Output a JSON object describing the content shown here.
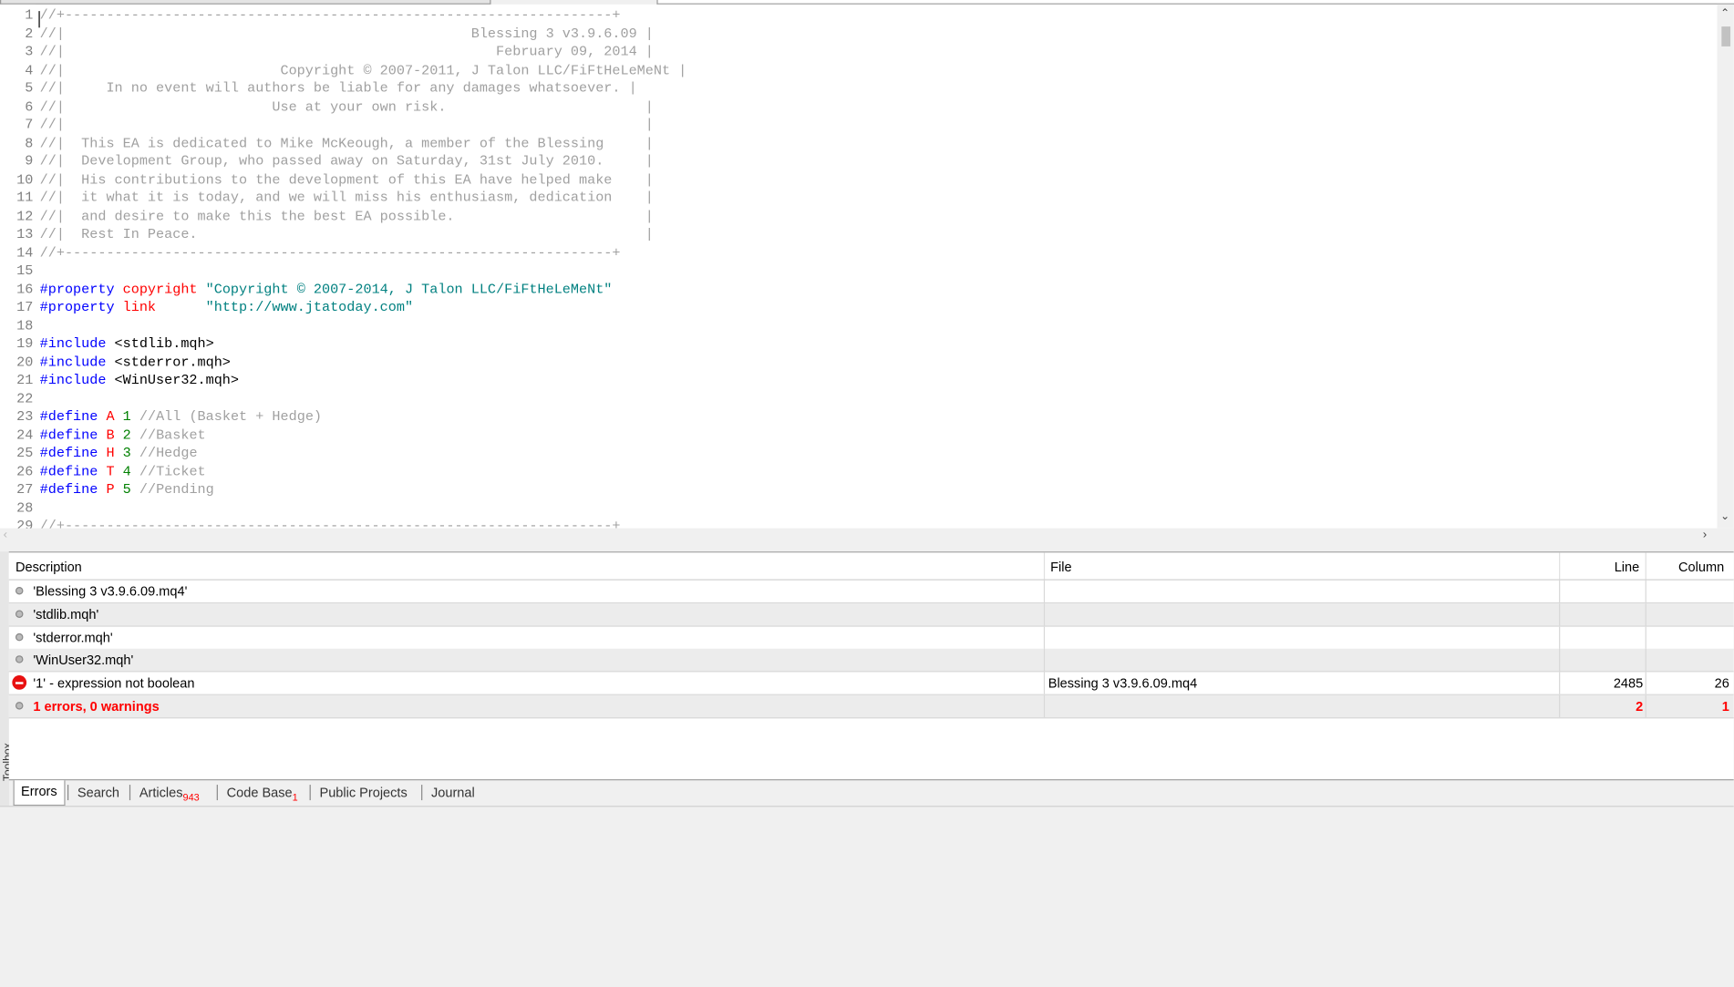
{
  "editor": {
    "lines": [
      {
        "n": "1",
        "segs": [
          {
            "t": "//+------------------------------------------------------------------+",
            "c": "cmt"
          }
        ]
      },
      {
        "n": "2",
        "segs": [
          {
            "t": "//|                                                 Blessing 3 v3.9.6.09 |",
            "c": "cmt"
          }
        ]
      },
      {
        "n": "3",
        "segs": [
          {
            "t": "//|                                                    February 09, 2014 |",
            "c": "cmt"
          }
        ]
      },
      {
        "n": "4",
        "segs": [
          {
            "t": "//|                          Copyright © 2007-2011, J Talon LLC/FiFtHeLeMeNt |",
            "c": "cmt"
          }
        ]
      },
      {
        "n": "5",
        "segs": [
          {
            "t": "//|     In no event will authors be liable for any damages whatsoever. |",
            "c": "cmt"
          }
        ]
      },
      {
        "n": "6",
        "segs": [
          {
            "t": "//|                         Use at your own risk.                        |",
            "c": "cmt"
          }
        ]
      },
      {
        "n": "7",
        "segs": [
          {
            "t": "//|                                                                      |",
            "c": "cmt"
          }
        ]
      },
      {
        "n": "8",
        "segs": [
          {
            "t": "//|  This EA is dedicated to Mike McKeough, a member of the Blessing     |",
            "c": "cmt"
          }
        ]
      },
      {
        "n": "9",
        "segs": [
          {
            "t": "//|  Development Group, who passed away on Saturday, 31st July 2010.     |",
            "c": "cmt"
          }
        ]
      },
      {
        "n": "10",
        "segs": [
          {
            "t": "//|  His contributions to the development of this EA have helped make    |",
            "c": "cmt"
          }
        ]
      },
      {
        "n": "11",
        "segs": [
          {
            "t": "//|  it what it is today, and we will miss his enthusiasm, dedication    |",
            "c": "cmt"
          }
        ]
      },
      {
        "n": "12",
        "segs": [
          {
            "t": "//|  and desire to make this the best EA possible.                       |",
            "c": "cmt"
          }
        ]
      },
      {
        "n": "13",
        "segs": [
          {
            "t": "//|  Rest In Peace.                                                      |",
            "c": "cmt"
          }
        ]
      },
      {
        "n": "14",
        "segs": [
          {
            "t": "//+------------------------------------------------------------------+",
            "c": "cmt"
          }
        ]
      },
      {
        "n": "15",
        "segs": []
      },
      {
        "n": "16",
        "segs": [
          {
            "t": "#property ",
            "c": "kw"
          },
          {
            "t": "copyright ",
            "c": "red"
          },
          {
            "t": "\"Copyright © 2007-2014, J Talon LLC/FiFtHeLeMeNt\"",
            "c": "str"
          }
        ]
      },
      {
        "n": "17",
        "segs": [
          {
            "t": "#property ",
            "c": "kw"
          },
          {
            "t": "link      ",
            "c": "red"
          },
          {
            "t": "\"http://www.jtatoday.com\"",
            "c": "str"
          }
        ]
      },
      {
        "n": "18",
        "segs": []
      },
      {
        "n": "19",
        "segs": [
          {
            "t": "#include ",
            "c": "kw"
          },
          {
            "t": "<stdlib.mqh>",
            "c": "blk"
          }
        ]
      },
      {
        "n": "20",
        "segs": [
          {
            "t": "#include ",
            "c": "kw"
          },
          {
            "t": "<stderror.mqh>",
            "c": "blk"
          }
        ]
      },
      {
        "n": "21",
        "segs": [
          {
            "t": "#include ",
            "c": "kw"
          },
          {
            "t": "<WinUser32.mqh>",
            "c": "blk"
          }
        ]
      },
      {
        "n": "22",
        "segs": []
      },
      {
        "n": "23",
        "segs": [
          {
            "t": "#define ",
            "c": "kw"
          },
          {
            "t": "A ",
            "c": "red"
          },
          {
            "t": "1 ",
            "c": "num"
          },
          {
            "t": "//All (Basket + Hedge)",
            "c": "cmt"
          }
        ]
      },
      {
        "n": "24",
        "segs": [
          {
            "t": "#define ",
            "c": "kw"
          },
          {
            "t": "B ",
            "c": "red"
          },
          {
            "t": "2 ",
            "c": "num"
          },
          {
            "t": "//Basket",
            "c": "cmt"
          }
        ]
      },
      {
        "n": "25",
        "segs": [
          {
            "t": "#define ",
            "c": "kw"
          },
          {
            "t": "H ",
            "c": "red"
          },
          {
            "t": "3 ",
            "c": "num"
          },
          {
            "t": "//Hedge",
            "c": "cmt"
          }
        ]
      },
      {
        "n": "26",
        "segs": [
          {
            "t": "#define ",
            "c": "kw"
          },
          {
            "t": "T ",
            "c": "red"
          },
          {
            "t": "4 ",
            "c": "num"
          },
          {
            "t": "//Ticket",
            "c": "cmt"
          }
        ]
      },
      {
        "n": "27",
        "segs": [
          {
            "t": "#define ",
            "c": "kw"
          },
          {
            "t": "P ",
            "c": "red"
          },
          {
            "t": "5 ",
            "c": "num"
          },
          {
            "t": "//Pending",
            "c": "cmt"
          }
        ]
      },
      {
        "n": "28",
        "segs": []
      },
      {
        "n": "29",
        "segs": [
          {
            "t": "//+------------------------------------------------------------------+",
            "c": "cmt"
          }
        ]
      }
    ]
  },
  "errors_panel": {
    "columns": {
      "description": "Description",
      "file": "File",
      "line": "Line",
      "column": "Column"
    },
    "rows": [
      {
        "description": "'Blessing 3 v3.9.6.09.mq4'",
        "file": "",
        "line": "",
        "column": "",
        "type": "info"
      },
      {
        "description": "'stdlib.mqh'",
        "file": "",
        "line": "",
        "column": "",
        "type": "info"
      },
      {
        "description": "'stderror.mqh'",
        "file": "",
        "line": "",
        "column": "",
        "type": "info"
      },
      {
        "description": "'WinUser32.mqh'",
        "file": "",
        "line": "",
        "column": "",
        "type": "info"
      },
      {
        "description": "'1' - expression not boolean",
        "file": "Blessing 3 v3.9.6.09.mq4",
        "line": "2485",
        "column": "26",
        "type": "error"
      },
      {
        "description": "1 errors, 0 warnings",
        "file": "",
        "line": "2",
        "column": "1",
        "type": "total"
      }
    ]
  },
  "toolbox": {
    "label": "Toolbox",
    "tabs": [
      {
        "label": "Errors",
        "badge": "",
        "active": true
      },
      {
        "label": "Search",
        "badge": "",
        "active": false
      },
      {
        "label": "Articles",
        "badge": "943",
        "active": false
      },
      {
        "label": "Code Base",
        "badge": "1",
        "active": false
      },
      {
        "label": "Public Projects",
        "badge": "",
        "active": false
      },
      {
        "label": "Journal",
        "badge": "",
        "active": false
      }
    ]
  }
}
